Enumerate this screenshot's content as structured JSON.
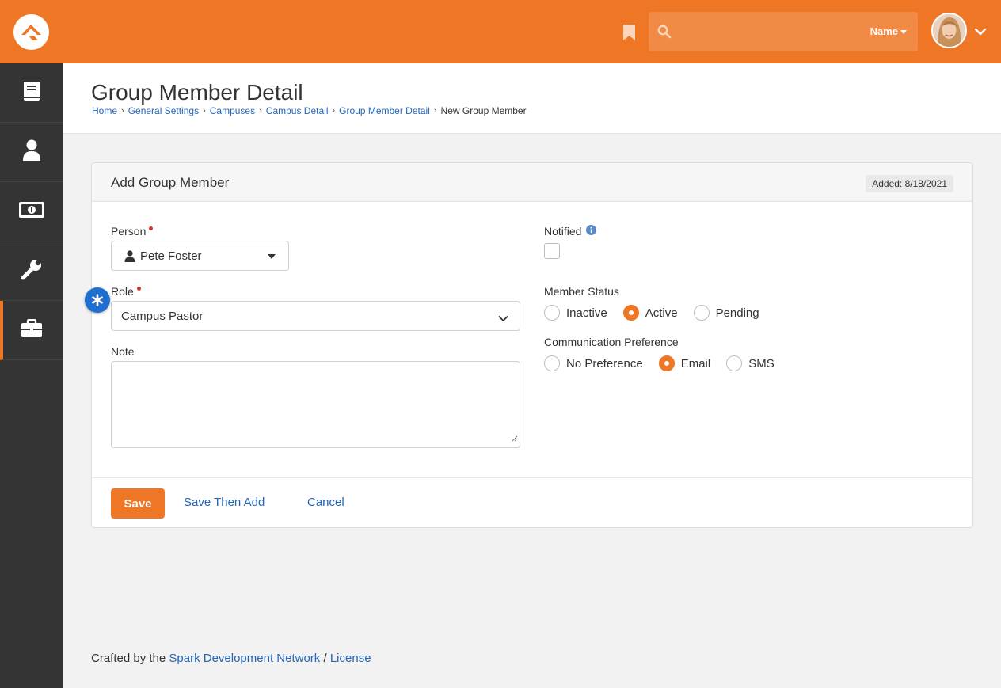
{
  "colors": {
    "brand": "#ee7625",
    "sidebar": "#343434",
    "link": "#2566b8",
    "required": "#d9332a",
    "marker": "#1f6fd1"
  },
  "topbar": {
    "logo_icon": "rock-logo-icon",
    "bookmark_icon": "bookmark-icon",
    "search": {
      "placeholder": "",
      "filter_label": "Name",
      "icon": "search-icon"
    },
    "avatar_icon": "user-avatar",
    "menu_icon": "chevron-down-icon"
  },
  "sidebar": {
    "items": [
      {
        "icon": "book-icon",
        "active": false
      },
      {
        "icon": "user-icon",
        "active": false
      },
      {
        "icon": "money-icon",
        "active": false
      },
      {
        "icon": "wrench-icon",
        "active": false
      },
      {
        "icon": "briefcase-icon",
        "active": true
      }
    ]
  },
  "page": {
    "title": "Group Member Detail",
    "breadcrumb": [
      "Home",
      "General Settings",
      "Campuses",
      "Campus Detail",
      "Group Member Detail",
      "New Group Member"
    ]
  },
  "panel": {
    "title": "Add Group Member",
    "added_badge": "Added: 8/18/2021",
    "person": {
      "label": "Person",
      "value": "Pete Foster"
    },
    "role": {
      "label": "Role",
      "value": "Campus Pastor"
    },
    "note": {
      "label": "Note",
      "value": ""
    },
    "notified": {
      "label": "Notified",
      "checked": false
    },
    "member_status": {
      "label": "Member Status",
      "options": [
        "Inactive",
        "Active",
        "Pending"
      ],
      "selected": "Active"
    },
    "communication": {
      "label": "Communication Preference",
      "options": [
        "No Preference",
        "Email",
        "SMS"
      ],
      "selected": "Email"
    },
    "actions": {
      "save": "Save",
      "save_then_add": "Save Then Add",
      "cancel": "Cancel"
    }
  },
  "footer": {
    "prefix": "Crafted by the",
    "link1": "Spark Development Network",
    "separator": "/",
    "link2": "License"
  }
}
